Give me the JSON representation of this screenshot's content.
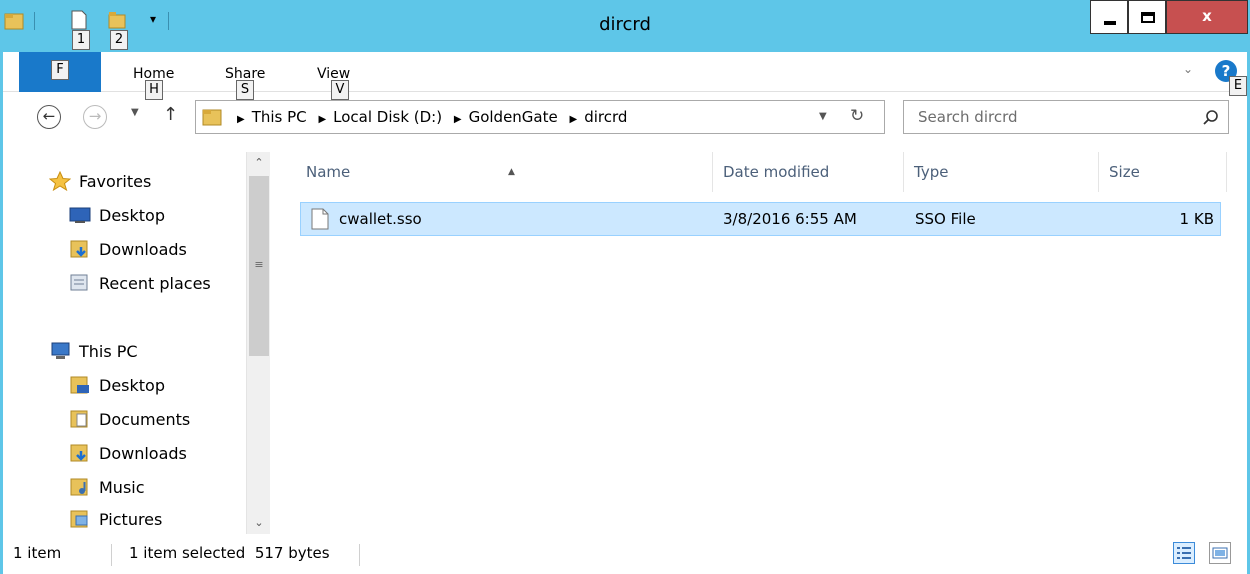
{
  "window": {
    "title": "dircrd",
    "close_label": "x"
  },
  "quick_access": {
    "keytip_1": "1",
    "keytip_2": "2",
    "dropdown": "▾"
  },
  "ribbon": {
    "file_keytip": "F",
    "tabs": [
      {
        "label": "Home",
        "keytip": "H"
      },
      {
        "label": "Share",
        "keytip": "S"
      },
      {
        "label": "View",
        "keytip": "V"
      }
    ],
    "help_keytip": "E",
    "help_label": "?"
  },
  "address": {
    "crumbs": [
      "This PC",
      "Local Disk (D:)",
      "GoldenGate",
      "dircrd"
    ]
  },
  "search": {
    "placeholder": "Search dircrd"
  },
  "navpane": {
    "favorites": {
      "label": "Favorites",
      "items": [
        "Desktop",
        "Downloads",
        "Recent places"
      ]
    },
    "this_pc": {
      "label": "This PC",
      "items": [
        "Desktop",
        "Documents",
        "Downloads",
        "Music",
        "Pictures"
      ]
    }
  },
  "columns": [
    "Name",
    "Date modified",
    "Type",
    "Size"
  ],
  "files": [
    {
      "name": "cwallet.sso",
      "date": "3/8/2016 6:55 AM",
      "type": "SSO File",
      "size": "1 KB"
    }
  ],
  "status": {
    "count": "1 item",
    "selection": "1 item selected  517 bytes"
  },
  "colors": {
    "titlebar": "#5ec6e8",
    "file_tab": "#1979ca",
    "close_button": "#c75050",
    "selection": "#cce8ff",
    "column_header_text": "#4c607a"
  }
}
